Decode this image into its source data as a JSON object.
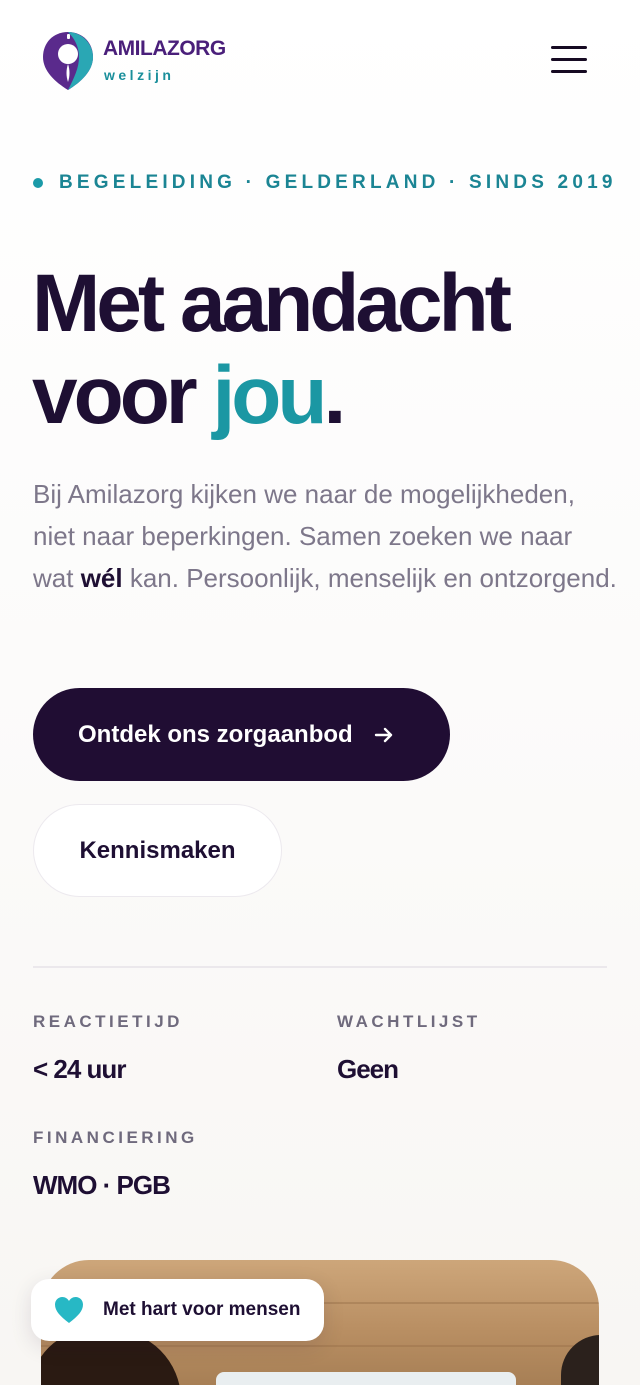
{
  "header": {
    "brand_name": "AMILAZORG",
    "brand_sub": "welzijn",
    "menu_icon": "hamburger-menu-icon"
  },
  "hero": {
    "eyebrow": "BEGELEIDING · GELDERLAND · SINDS 2019",
    "headline_line1": "Met aandacht",
    "headline_line2_start": "voor ",
    "headline_accent": "jou",
    "headline_end": ".",
    "lead_before": "Bij Amilazorg kijken we naar de mogelijkheden, niet naar beperkingen. Samen zoeken we naar wat ",
    "lead_bold": "wél",
    "lead_after": " kan. Persoonlijk, menselijk en ontzorgend.",
    "cta_primary": "Ontdek ons zorgaanbod",
    "cta_secondary": "Kennismaken"
  },
  "stats": [
    {
      "label": "REACTIETIJD",
      "value": "< 24 uur"
    },
    {
      "label": "WACHTLIJST",
      "value": "Geen"
    },
    {
      "label": "FINANCIERING",
      "value": "WMO · PGB"
    }
  ],
  "badge": {
    "text": "Met hart voor mensen",
    "icon": "heart-icon"
  },
  "colors": {
    "primary": "#200d33",
    "accent": "#1b97a3",
    "brand_purple": "#4a1f7a",
    "muted_text": "#7d778a"
  }
}
